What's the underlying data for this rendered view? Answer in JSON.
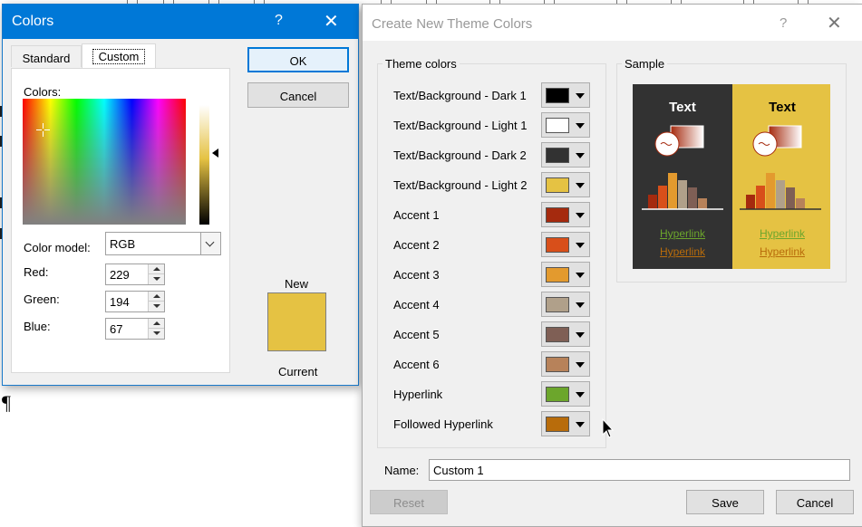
{
  "colors_dialog": {
    "title": "Colors",
    "help": "?",
    "close": "✕",
    "tabs": [
      "Standard",
      "Custom"
    ],
    "colors_label": "Colors:",
    "color_model_label": "Color model:",
    "color_model_value": "RGB",
    "red_label": "Red:",
    "red_value": "229",
    "green_label": "Green:",
    "green_value": "194",
    "blue_label": "Blue:",
    "blue_value": "67",
    "ok_label": "OK",
    "cancel_label": "Cancel",
    "new_label": "New",
    "current_label": "Current",
    "new_color": "#e5c243"
  },
  "document": {
    "pilcrow": "¶"
  },
  "theme_dialog": {
    "title": "Create New Theme Colors",
    "help": "?",
    "close": "✕",
    "theme_colors_label": "Theme colors",
    "sample_label": "Sample",
    "rows": [
      {
        "label": "Text/Background - Dark 1",
        "color": "#000000"
      },
      {
        "label": "Text/Background - Light 1",
        "color": "#ffffff"
      },
      {
        "label": "Text/Background - Dark 2",
        "color": "#323232"
      },
      {
        "label": "Text/Background - Light 2",
        "color": "#e5c243"
      },
      {
        "label": "Accent 1",
        "color": "#a52a0e"
      },
      {
        "label": "Accent 2",
        "color": "#d84f1a"
      },
      {
        "label": "Accent 3",
        "color": "#e39a2e"
      },
      {
        "label": "Accent 4",
        "color": "#b0a08a"
      },
      {
        "label": "Accent 5",
        "color": "#7f5f55"
      },
      {
        "label": "Accent 6",
        "color": "#b7825a"
      },
      {
        "label": "Hyperlink",
        "color": "#6ca62c"
      },
      {
        "label": "Followed Hyperlink",
        "color": "#b86c0b"
      }
    ],
    "sample": {
      "text_label": "Text",
      "hyperlink_label": "Hyperlink",
      "followed_label": "Hyperlink"
    },
    "name_label": "Name:",
    "name_value": "Custom 1",
    "reset_label": "Reset",
    "save_label": "Save",
    "cancel_label": "Cancel"
  }
}
